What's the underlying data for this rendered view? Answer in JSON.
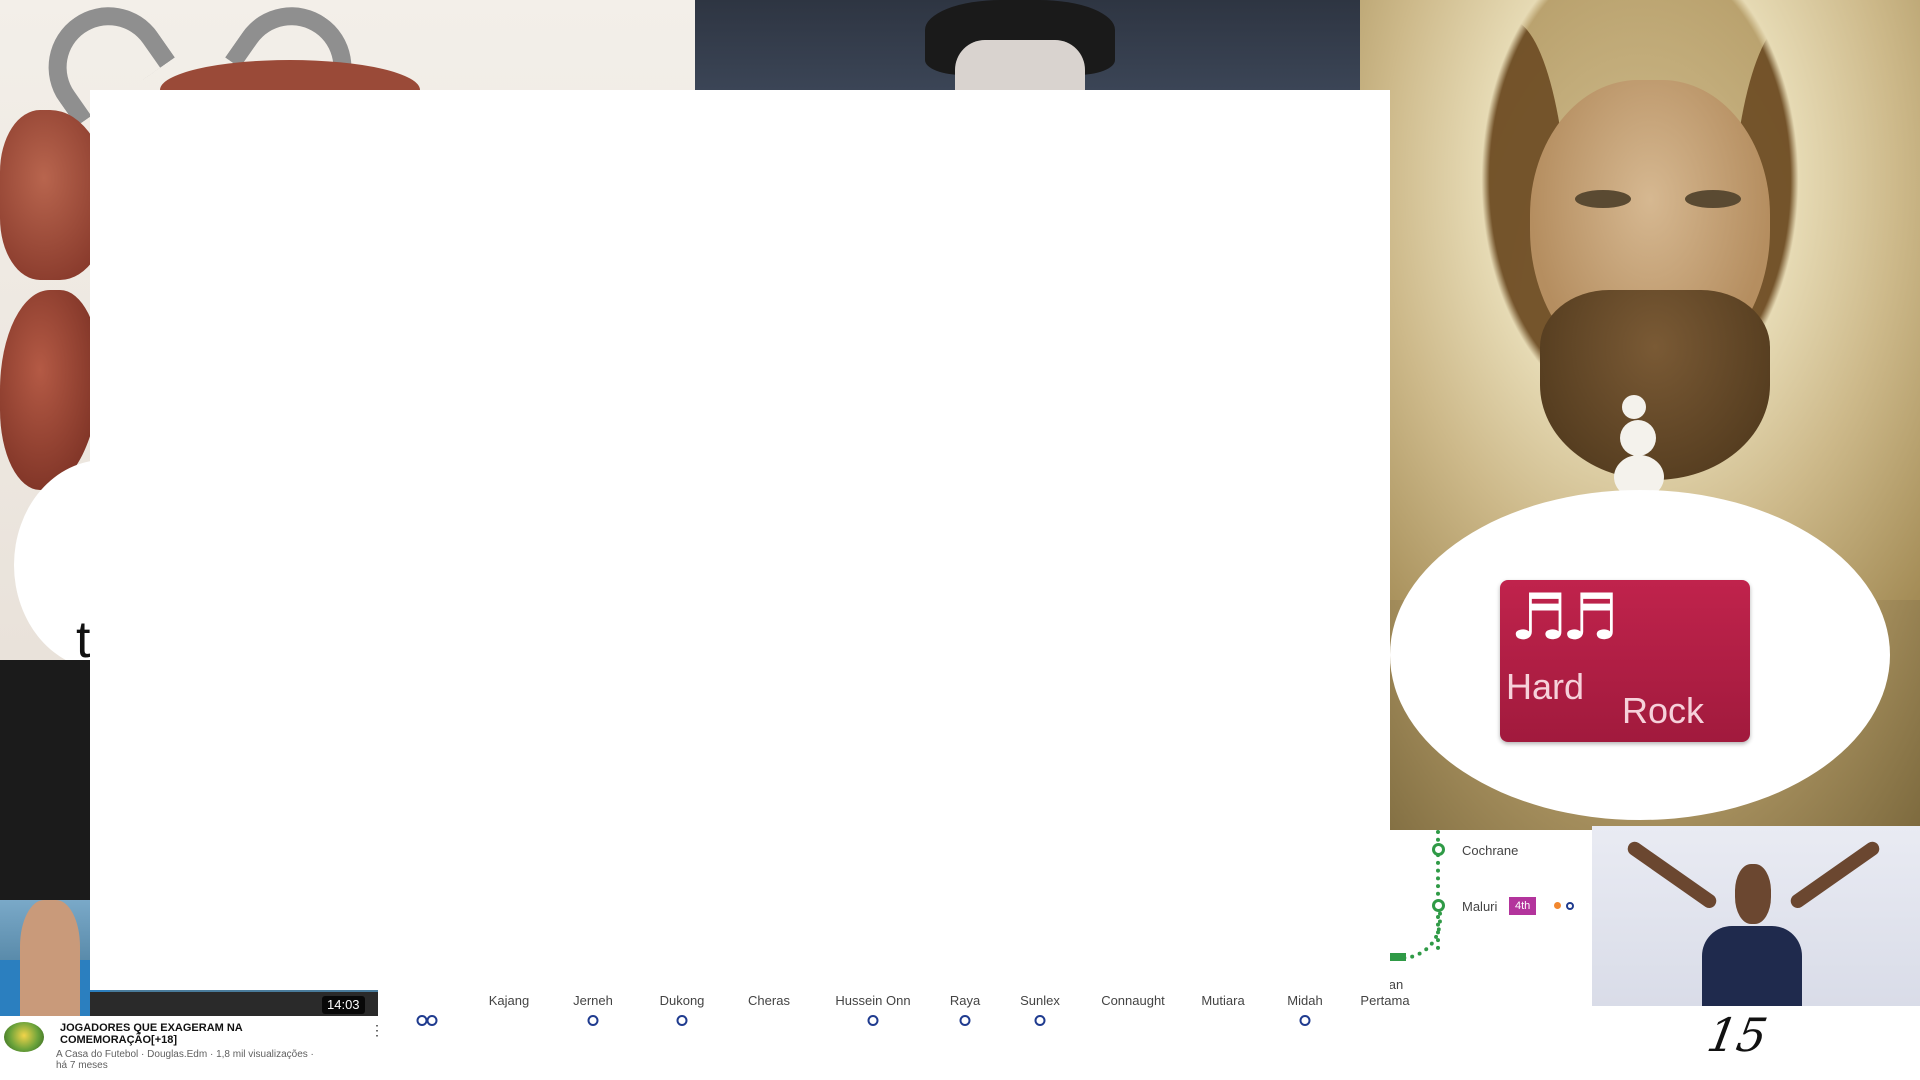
{
  "collage": {
    "bull_bubble_text": "t",
    "hard_rock": {
      "notes": "♬♬",
      "word1": "Hard",
      "word2": "Rock",
      "bg_color": "#b01f45"
    },
    "handwritten_number": "15"
  },
  "video_card": {
    "duration": "14:03",
    "title": "JOGADORES QUE EXAGERAM NA COMEMORAÇÃO[+18]",
    "meta": "A Casa do Futebol · Douglas.Edm · 1,8 mil visualizações · há 7 meses",
    "more_icon": "⋮"
  },
  "transit_map": {
    "line_color": "#1f3b8f",
    "green_line_color": "#2f9a46",
    "stations": [
      "Kajang",
      "Jerneh",
      "Dukong",
      "Cheras",
      "Hussein Onn",
      "Raya",
      "Sunlex",
      "Connaught",
      "Mutiara",
      "Midah",
      "Pertama"
    ],
    "right_stations": [
      "Cochrane",
      "Maluri"
    ],
    "interchange_badge": "4th",
    "interchange_badge_color": "#b3349c",
    "partial_label": "an"
  }
}
